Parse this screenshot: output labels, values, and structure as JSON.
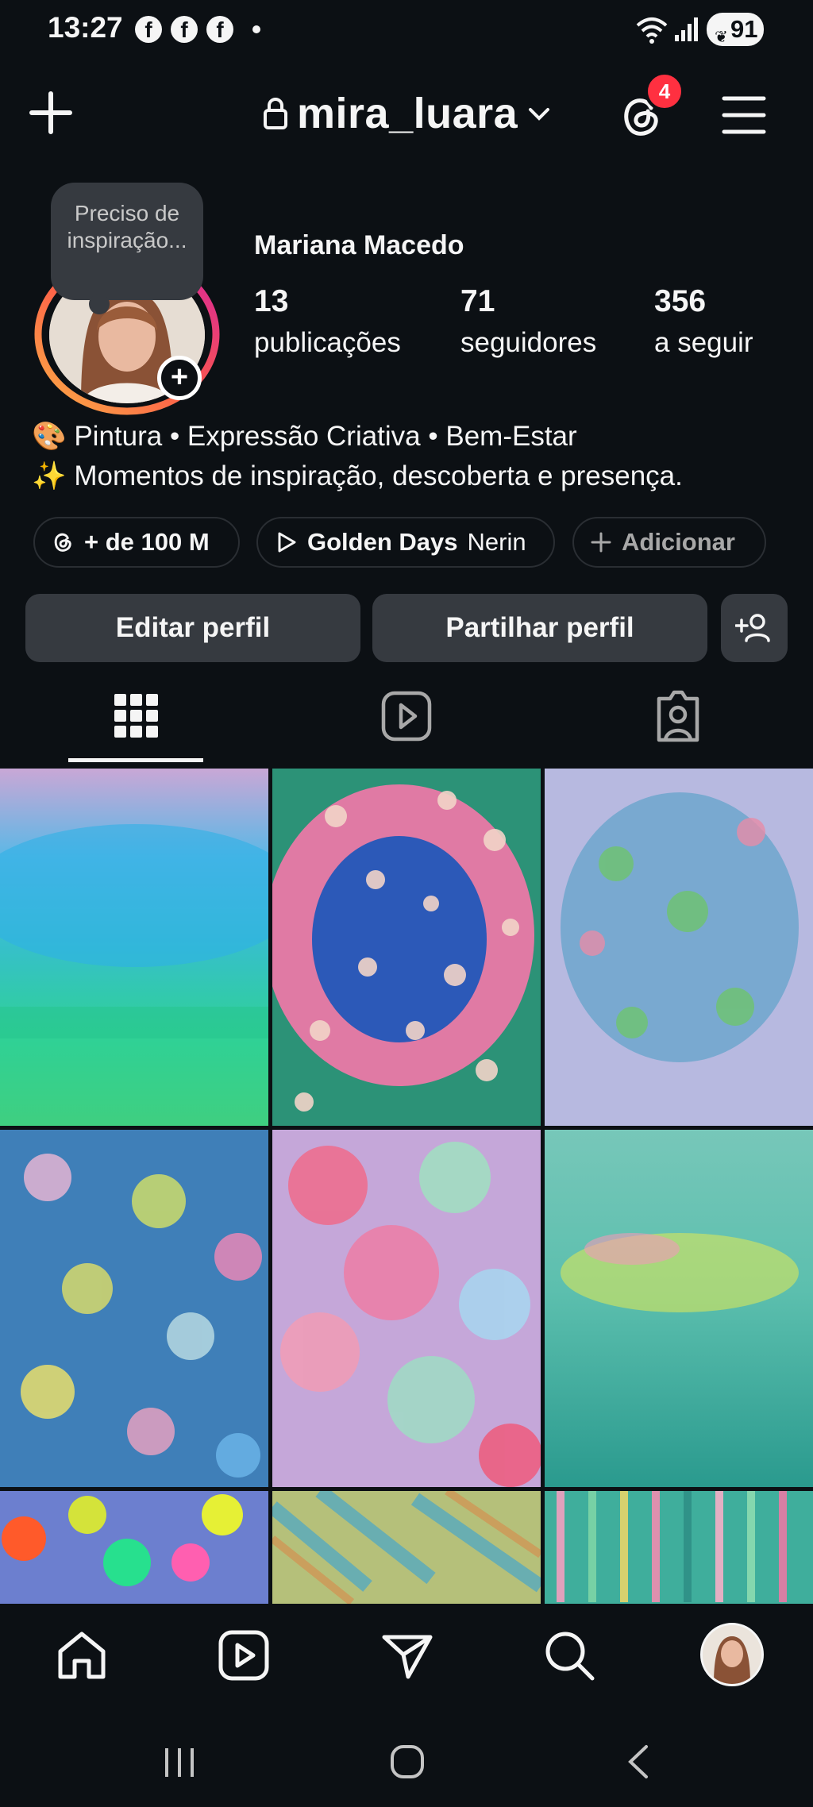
{
  "status_bar": {
    "time": "13:27",
    "app_icons": [
      "facebook-icon",
      "facebook-icon",
      "facebook-icon"
    ],
    "battery": "91"
  },
  "header": {
    "username": "mira_luara",
    "threads_badge": "4"
  },
  "profile": {
    "note": "Preciso de inspiração...",
    "full_name": "Mariana Macedo",
    "stats": [
      {
        "value": "13",
        "label": "publicações"
      },
      {
        "value": "71",
        "label": "seguidores"
      },
      {
        "value": "356",
        "label": "a seguir"
      }
    ],
    "bio": [
      {
        "emoji": "🎨",
        "text": "Pintura • Expressão Criativa • Bem-Estar"
      },
      {
        "emoji": "✨",
        "text": "Momentos de inspiração, descoberta e presença."
      }
    ]
  },
  "chips": {
    "threads": "+ de 100 M",
    "music_title": "Golden Days",
    "music_artist": "Nerin",
    "add": "Adicionar"
  },
  "actions": {
    "edit": "Editar perfil",
    "share": "Partilhar perfil"
  },
  "tabs": [
    "grid-icon",
    "reels-icon",
    "tagged-icon"
  ],
  "colors": {
    "background": "#0c1014",
    "button": "#363a40",
    "badge": "#ff3040",
    "story_ring_start": "#fcaf45",
    "story_ring_end": "#e1306c"
  }
}
